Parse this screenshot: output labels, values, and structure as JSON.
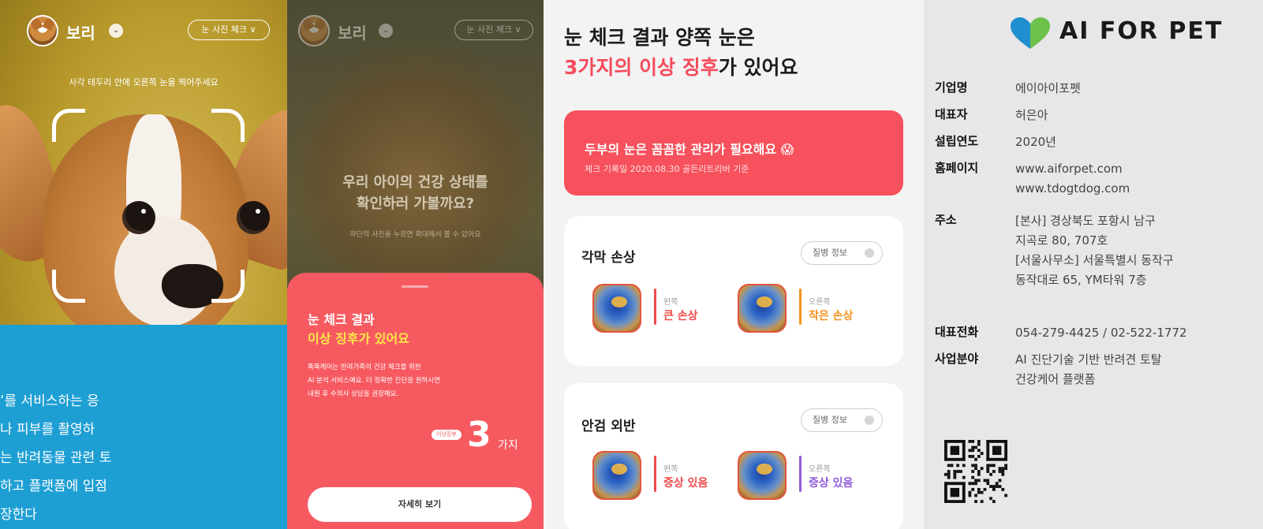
{
  "camera_screen": {
    "pet_name": "보리",
    "check_pill": "눈 사진 체크 ∨",
    "guide": "사각 테두리 안에 오른쪽 눈을 찍어주세요",
    "caption_lines": [
      "’를 서비스하는 응",
      "나 피부를 촬영하",
      "는 반려동물 관련 토",
      "하고 플랫폼에 입점",
      "장한다"
    ]
  },
  "result_sheet": {
    "pet_name": "보리",
    "check_pill": "눈 사진 체크 ∨",
    "overlay_title_1": "우리 아이의 건강 상태를",
    "overlay_title_2": "확인하러 가볼까요?",
    "overlay_sub": "하단의 사진을 누르면 확대해서 볼 수 있어요",
    "title_1": "눈 체크 결과",
    "title_2": "이상 징후가 있어요",
    "desc_lines": [
      "똑똑케어는 반려가족의 건강 체크를 위한",
      "AI 분석 서비스예요. 더 정확한 진단을 원하시면",
      "내원 후 수의사 상담을 권장해요."
    ],
    "count_tag": "이상징후",
    "count": "3",
    "count_unit": "가지",
    "more_button": "자세히 보기"
  },
  "detail": {
    "title_line1": "눈 체크 결과 양쪽 눈은",
    "title_highlight": "3가지의 이상 징후",
    "title_rest": "가 있어요",
    "alert_heading": "두부의 눈은 꼼꼼한 관리가 필요해요 😱",
    "alert_sub": "체크 기록일 2020.08.30  골든리트리버 기준",
    "info_button": "질병 정보",
    "cards": [
      {
        "name": "각막 손상",
        "left_label": "왼쪽",
        "left_value": "큰 손상",
        "left_color": "#f14a4a",
        "right_label": "오른쪽",
        "right_value": "작은 손상",
        "right_color": "#f5911e"
      },
      {
        "name": "안검 외반",
        "left_label": "왼쪽",
        "left_value": "증상 있음",
        "left_color": "#f14a4a",
        "right_label": "오른쪽",
        "right_value": "증상 있음",
        "right_color": "#8e5bd8"
      }
    ]
  },
  "company": {
    "logo_text": "AI FOR PET",
    "rows": [
      {
        "key": "기업명",
        "lines": [
          "에이아이포펫"
        ]
      },
      {
        "key": "대표자",
        "lines": [
          "허은아"
        ]
      },
      {
        "key": "설립연도",
        "lines": [
          "2020년"
        ]
      },
      {
        "key": "홈페이지",
        "lines": [
          "www.aiforpet.com",
          "www.tdogtdog.com"
        ]
      },
      {
        "key": "주소",
        "lines": [
          "[본사] 경상북도 포항시 남구",
          "지곡로 80, 707호",
          "[서울사무소] 서울특별시 동작구",
          "동작대로 65, YM타워 7층"
        ]
      },
      {
        "key": "대표전화",
        "lines": [
          "054-279-4425 / 02-522-1772"
        ]
      },
      {
        "key": "사업분야",
        "lines": [
          "AI 진단기술 기반 반려견 토탈",
          "건강케어 플랫폼"
        ]
      }
    ]
  },
  "colors": {
    "accent_red": "#f6515c",
    "highlight_yellow": "#ffe74a",
    "caption_blue": "#1e9fd4",
    "logo_green": "#6cc24a",
    "logo_blue": "#1f8fd0"
  }
}
